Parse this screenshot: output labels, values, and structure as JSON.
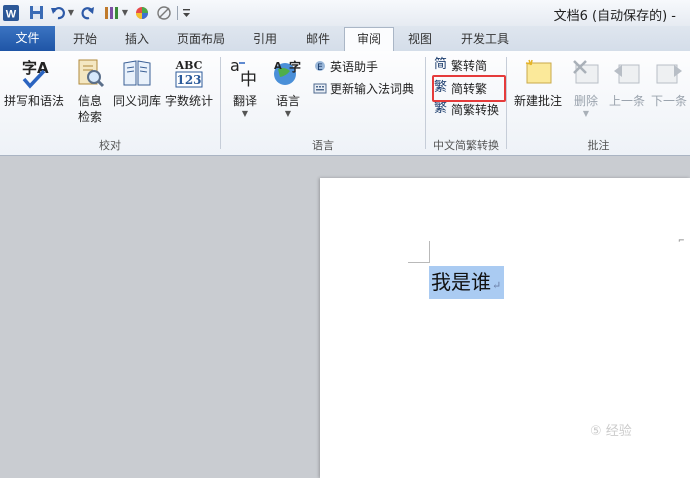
{
  "title_bar": {
    "document_title": "文档6 (自动保存的) -"
  },
  "ribbon_tabs": [
    "文件",
    "开始",
    "插入",
    "页面布局",
    "引用",
    "邮件",
    "审阅",
    "视图",
    "开发工具"
  ],
  "active_tab": "审阅",
  "groups": {
    "proofing": {
      "label": "校对",
      "buttons": {
        "spelling": "拼写和语法",
        "research_line1": "信息",
        "research_line2": "检索",
        "thesaurus": "同义词库",
        "word_count": "字数统计"
      },
      "word_count_icon_text": {
        "line1": "ABC",
        "line2": "123"
      }
    },
    "language": {
      "label": "语言",
      "buttons": {
        "translate": "翻译",
        "language": "语言",
        "english_assistant": "英语助手",
        "update_ime": "更新输入法词典"
      }
    },
    "chinese_conversion": {
      "label": "中文简繁转换",
      "buttons": {
        "trad_to_simp": "繁转简",
        "simp_to_trad": "简转繁",
        "conversion": "简繁转换"
      },
      "icon_glyphs": {
        "trad_to_simp": "简",
        "simp_to_trad": "繁",
        "conversion": "繁"
      }
    },
    "comments": {
      "label": "批注",
      "buttons": {
        "new_comment": "新建批注",
        "delete": "删除",
        "previous": "上一条",
        "next": "下一条"
      }
    }
  },
  "document": {
    "selected_text": "我是谁",
    "paragraph_mark": "↵"
  },
  "watermark": "⑤ 经验",
  "colors": {
    "file_tab": "#2a5fb0",
    "selection": "#aacbf2",
    "highlight_box": "#e53b3b"
  }
}
